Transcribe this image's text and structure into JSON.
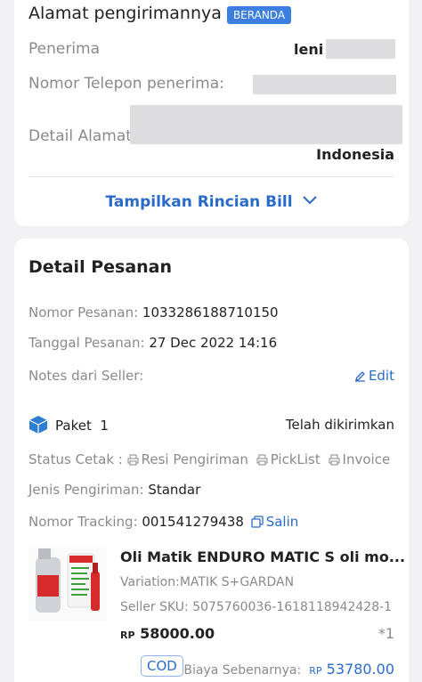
{
  "address": {
    "title": "Alamat pengirimannya",
    "badge": "BERANDA",
    "recipient_label": "Penerima",
    "recipient_value": "leni r",
    "phone_label": "Nomor Telepon penerima:",
    "detail_label": "Detail Alamat",
    "country": "Indonesia",
    "toggle_label": "Tampilkan Rincian Bill"
  },
  "order": {
    "title": "Detail Pesanan",
    "number_label": "Nomor Pesanan: ",
    "number_value": "1033286188710150",
    "date_label": "Tanggal Pesanan: ",
    "date_value": "27 Dec 2022 14:16",
    "notes_label": "Notes dari Seller:",
    "edit_label": "Edit",
    "package_label": "Paket",
    "package_number": "1",
    "package_status": "Telah dikirimkan",
    "print_label": "Status Cetak : ",
    "print_resi": "Resi Pengiriman",
    "print_picklist": "PickList",
    "print_invoice": "Invoice",
    "shipping_label": "Jenis Pengiriman: ",
    "shipping_value": "Standar",
    "tracking_label": "Nomor Tracking: ",
    "tracking_value": "001541279438",
    "copy_label": "Salin"
  },
  "product": {
    "name": "Oli Matik ENDURO MATIC S oli mo...",
    "variation": "Variation:MATIK S+GARDAN",
    "sku": "Seller SKU: 5075760036-1618118942428-1",
    "currency": "RP",
    "price": "58000.00",
    "quantity": "*1",
    "payment_badge": "COD",
    "actual_cost_label": "Biaya Sebenarnya:",
    "actual_cost_currency": "RP",
    "actual_cost_value": "53780.00"
  },
  "colors": {
    "accent": "#2a6bc9",
    "badge": "#3d7fe0",
    "background": "#f1f1f3",
    "mask": "#dddde0"
  }
}
